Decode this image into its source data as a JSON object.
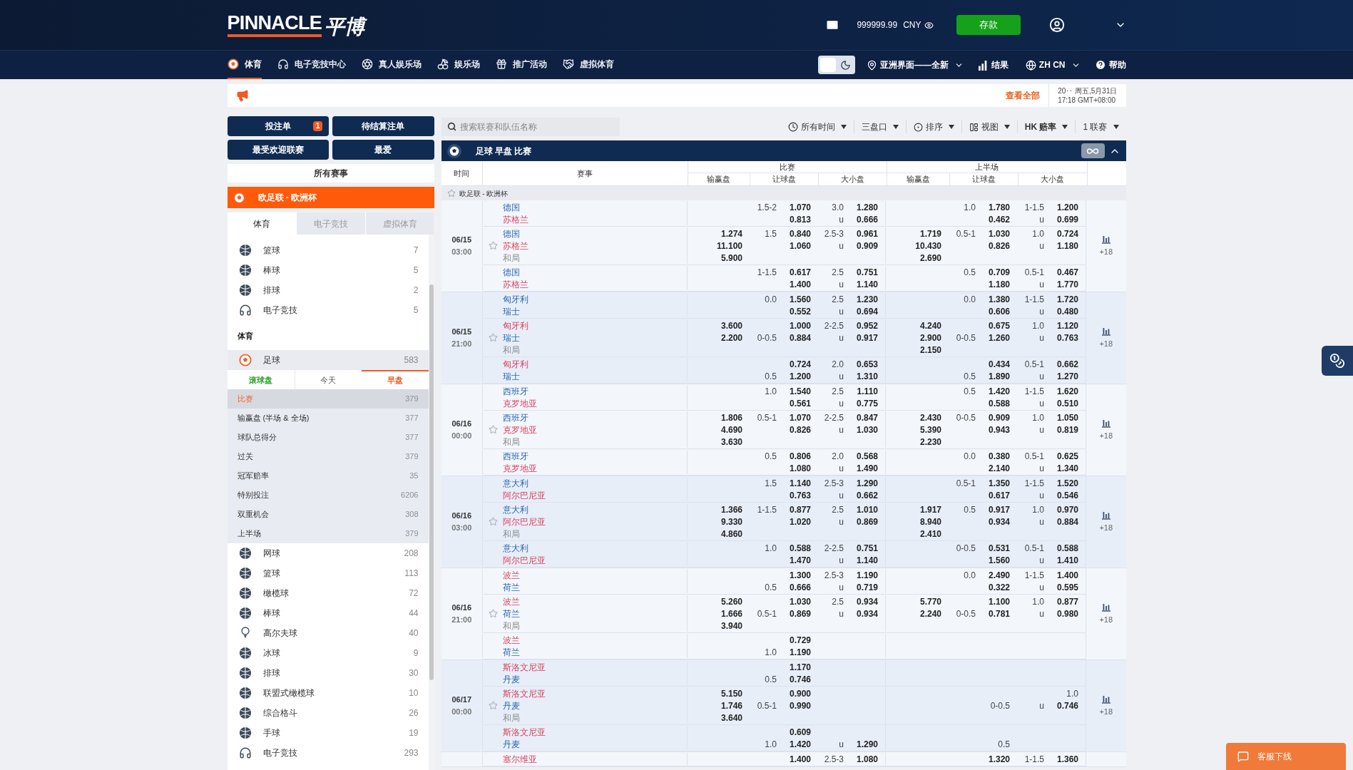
{
  "header": {
    "logo": "PINNACLE",
    "logo_cn": "平博",
    "balance": "999999.99",
    "currency": "CNY",
    "deposit": "存款"
  },
  "nav": [
    {
      "label": "体育",
      "selected": true
    },
    {
      "label": "电子竞技中心",
      "selected": false
    },
    {
      "label": "真人娱乐场",
      "selected": false
    },
    {
      "label": "娱乐场",
      "selected": false
    },
    {
      "label": "推广活动",
      "selected": false
    },
    {
      "label": "虚拟体育",
      "selected": false
    }
  ],
  "nav_right": {
    "dark_mode": false,
    "view": "亚洲界面——全新",
    "results": "结果",
    "language": "ZH CN",
    "help": "帮助"
  },
  "announcement": {
    "view_all": "查看全部",
    "date": "20‥ 周五,5月31日",
    "time": "17:18 GMT+08:00"
  },
  "sidebar": {
    "buttons": [
      {
        "label": "投注单",
        "badge": "1"
      },
      {
        "label": "待结算注单"
      },
      {
        "label": "最受欢迎联赛"
      },
      {
        "label": "最爱"
      }
    ],
    "all_events": "所有赛事",
    "league": "欧足联 - 欧洲杯",
    "tabs": [
      {
        "label": "体育",
        "selected": true
      },
      {
        "label": "电子竞技",
        "selected": false
      },
      {
        "label": "虚拟体育",
        "selected": false
      }
    ],
    "top_sports": [
      {
        "name": "篮球",
        "count": "7"
      },
      {
        "name": "棒球",
        "count": "5"
      },
      {
        "name": "排球",
        "count": "2"
      },
      {
        "name": "电子竞技",
        "count": "5"
      }
    ],
    "section": "体育",
    "featured": {
      "name": "足球",
      "count": "583",
      "expanded": true,
      "periods": [
        {
          "label": "滚球盘",
          "selected": false
        },
        {
          "label": "今天",
          "selected": false
        },
        {
          "label": "早盘",
          "selected": true
        }
      ],
      "markets": [
        {
          "name": "比赛",
          "count": "379",
          "selected": true
        },
        {
          "name": "输赢盘 (半场 & 全场)",
          "count": "377",
          "selected": false
        },
        {
          "name": "球队总得分",
          "count": "377",
          "selected": false
        },
        {
          "name": "过关",
          "count": "379",
          "selected": false
        },
        {
          "name": "冠军赔率",
          "count": "35",
          "selected": false
        },
        {
          "name": "特别投注",
          "count": "6206",
          "selected": false
        },
        {
          "name": "双重机会",
          "count": "308",
          "selected": false
        },
        {
          "name": "上半场",
          "count": "379",
          "selected": false
        }
      ]
    },
    "sports": [
      {
        "name": "网球",
        "count": "208"
      },
      {
        "name": "篮球",
        "count": "113"
      },
      {
        "name": "橄榄球",
        "count": "72"
      },
      {
        "name": "棒球",
        "count": "44"
      },
      {
        "name": "高尔夫球",
        "count": "40"
      },
      {
        "name": "冰球",
        "count": "9"
      },
      {
        "name": "排球",
        "count": "30"
      },
      {
        "name": "联盟式橄榄球",
        "count": "10"
      },
      {
        "name": "综合格斗",
        "count": "26"
      },
      {
        "name": "手球",
        "count": "19"
      },
      {
        "name": "电子竞技",
        "count": "293"
      }
    ]
  },
  "toolbar": {
    "search_placeholder": "搜索联赛和队伍名称",
    "filters": [
      "所有时间",
      "三盘口",
      "排序",
      "视图",
      "HK 赔率",
      "1 联赛"
    ]
  },
  "table": {
    "title": "足球 早盘 比赛",
    "time_header": "时间",
    "event_header": "赛事",
    "column_groups": [
      {
        "label": "比赛",
        "columns": [
          "输赢盘",
          "让球盘",
          "大小盘"
        ]
      },
      {
        "label": "上半场",
        "columns": [
          "输赢盘",
          "让球盘",
          "大小盘"
        ]
      }
    ],
    "league": "欧足联 - 欧洲杯",
    "groups": [
      {
        "date": "06/15",
        "time": "03:00",
        "more": "+18",
        "lines": [
          {
            "teams": [
              {
                "name": "德国",
                "favorite": false
              },
              {
                "name": "苏格兰",
                "favorite": true
              }
            ],
            "rows": [
              {
                "hdp": "1.5-2",
                "hdp_odds": "1.070",
                "ou": "3.0",
                "ou_odds": "1.280",
                "h1_hdp": "1.0",
                "h1_hdp_odds": "1.780",
                "h1_ou": "1-1.5",
                "h1_ou_odds": "1.200"
              },
              {
                "hdp_odds": "0.813",
                "ou": "u",
                "ou_odds": "0.666",
                "h1_hdp_odds": "0.462",
                "h1_ou": "u",
                "h1_ou_odds": "0.699"
              }
            ]
          },
          {
            "teams": [
              {
                "name": "德国",
                "favorite": false
              },
              {
                "name": "苏格兰",
                "favorite": true
              }
            ],
            "draw": "和局",
            "rows": [
              {
                "ml": "1.274",
                "hdp": "1.5",
                "hdp_odds": "0.840",
                "ou": "2.5-3",
                "ou_odds": "0.961",
                "h1_ml": "1.719",
                "h1_hdp": "0.5-1",
                "h1_hdp_odds": "1.030",
                "h1_ou": "1.0",
                "h1_ou_odds": "0.724"
              },
              {
                "ml": "11.100",
                "hdp_odds": "1.060",
                "ou": "u",
                "ou_odds": "0.909",
                "h1_ml": "10.430",
                "h1_hdp_odds": "0.826",
                "h1_ou": "u",
                "h1_ou_odds": "1.180"
              },
              {
                "ml": "5.900",
                "h1_ml": "2.690"
              }
            ]
          },
          {
            "teams": [
              {
                "name": "德国",
                "favorite": false
              },
              {
                "name": "苏格兰",
                "favorite": true
              }
            ],
            "rows": [
              {
                "hdp": "1-1.5",
                "hdp_odds": "0.617",
                "ou": "2.5",
                "ou_odds": "0.751",
                "h1_hdp": "0.5",
                "h1_hdp_odds": "0.709",
                "h1_ou": "0.5-1",
                "h1_ou_odds": "0.467"
              },
              {
                "hdp_odds": "1.400",
                "ou": "u",
                "ou_odds": "1.140",
                "h1_hdp_odds": "1.180",
                "h1_ou": "u",
                "h1_ou_odds": "1.770"
              }
            ]
          }
        ]
      },
      {
        "date": "06/15",
        "time": "21:00",
        "more": "+18",
        "lines": [
          {
            "teams": [
              {
                "name": "匈牙利",
                "favorite": false
              },
              {
                "name": "瑞士",
                "favorite": false
              }
            ],
            "rows": [
              {
                "hdp": "0.0",
                "hdp_odds": "1.560",
                "ou": "2.5",
                "ou_odds": "1.230",
                "h1_hdp": "0.0",
                "h1_hdp_odds": "1.380",
                "h1_ou": "1-1.5",
                "h1_ou_odds": "1.720"
              },
              {
                "hdp_odds": "0.552",
                "ou": "u",
                "ou_odds": "0.694",
                "h1_hdp_odds": "0.606",
                "h1_ou": "u",
                "h1_ou_odds": "0.480"
              }
            ]
          },
          {
            "teams": [
              {
                "name": "匈牙利",
                "favorite": true
              },
              {
                "name": "瑞士",
                "favorite": false
              }
            ],
            "draw": "和局",
            "rows": [
              {
                "ml": "3.600",
                "hdp_odds": "1.000",
                "ou": "2-2.5",
                "ou_odds": "0.952",
                "h1_ml": "4.240",
                "h1_hdp_odds": "0.675",
                "h1_ou": "1.0",
                "h1_ou_odds": "1.120"
              },
              {
                "ml": "2.200",
                "hdp": "0-0.5",
                "hdp_odds": "0.884",
                "ou": "u",
                "ou_odds": "0.917",
                "h1_ml": "2.900",
                "h1_hdp": "0-0.5",
                "h1_hdp_odds": "1.260",
                "h1_ou": "u",
                "h1_ou_odds": "0.763"
              },
              {
                "h1_ml": "2.150"
              }
            ]
          },
          {
            "teams": [
              {
                "name": "匈牙利",
                "favorite": true
              },
              {
                "name": "瑞士",
                "favorite": false
              }
            ],
            "rows": [
              {
                "hdp_odds": "0.724",
                "ou": "2.0",
                "ou_odds": "0.653",
                "h1_hdp_odds": "0.434",
                "h1_ou": "0.5-1",
                "h1_ou_odds": "0.662"
              },
              {
                "hdp": "0.5",
                "hdp_odds": "1.200",
                "ou": "u",
                "ou_odds": "1.310",
                "h1_hdp": "0.5",
                "h1_hdp_odds": "1.890",
                "h1_ou": "u",
                "h1_ou_odds": "1.270"
              }
            ]
          }
        ]
      },
      {
        "date": "06/16",
        "time": "00:00",
        "more": "+18",
        "lines": [
          {
            "teams": [
              {
                "name": "西班牙",
                "favorite": false
              },
              {
                "name": "克罗地亚",
                "favorite": true
              }
            ],
            "rows": [
              {
                "hdp": "1.0",
                "hdp_odds": "1.540",
                "ou": "2.5",
                "ou_odds": "1.110",
                "h1_hdp": "0.5",
                "h1_hdp_odds": "1.420",
                "h1_ou": "1-1.5",
                "h1_ou_odds": "1.620"
              },
              {
                "hdp_odds": "0.561",
                "ou": "u",
                "ou_odds": "0.775",
                "h1_hdp_odds": "0.588",
                "h1_ou": "u",
                "h1_ou_odds": "0.510"
              }
            ]
          },
          {
            "teams": [
              {
                "name": "西班牙",
                "favorite": false
              },
              {
                "name": "克罗地亚",
                "favorite": true
              }
            ],
            "draw": "和局",
            "rows": [
              {
                "ml": "1.806",
                "hdp": "0.5-1",
                "hdp_odds": "1.070",
                "ou": "2-2.5",
                "ou_odds": "0.847",
                "h1_ml": "2.430",
                "h1_hdp": "0-0.5",
                "h1_hdp_odds": "0.909",
                "h1_ou": "1.0",
                "h1_ou_odds": "1.050"
              },
              {
                "ml": "4.690",
                "hdp_odds": "0.826",
                "ou": "u",
                "ou_odds": "1.030",
                "h1_ml": "5.390",
                "h1_hdp_odds": "0.943",
                "h1_ou": "u",
                "h1_ou_odds": "0.819"
              },
              {
                "ml": "3.630",
                "h1_ml": "2.230"
              }
            ]
          },
          {
            "teams": [
              {
                "name": "西班牙",
                "favorite": false
              },
              {
                "name": "克罗地亚",
                "favorite": true
              }
            ],
            "rows": [
              {
                "hdp": "0.5",
                "hdp_odds": "0.806",
                "ou": "2.0",
                "ou_odds": "0.568",
                "h1_hdp": "0.0",
                "h1_hdp_odds": "0.380",
                "h1_ou": "0.5-1",
                "h1_ou_odds": "0.625"
              },
              {
                "hdp_odds": "1.080",
                "ou": "u",
                "ou_odds": "1.490",
                "h1_hdp_odds": "2.140",
                "h1_ou": "u",
                "h1_ou_odds": "1.340"
              }
            ]
          }
        ]
      },
      {
        "date": "06/16",
        "time": "03:00",
        "more": "+18",
        "lines": [
          {
            "teams": [
              {
                "name": "意大利",
                "favorite": false
              },
              {
                "name": "阿尔巴尼亚",
                "favorite": true
              }
            ],
            "rows": [
              {
                "hdp": "1.5",
                "hdp_odds": "1.140",
                "ou": "2.5-3",
                "ou_odds": "1.290",
                "h1_hdp": "0.5-1",
                "h1_hdp_odds": "1.350",
                "h1_ou": "1-1.5",
                "h1_ou_odds": "1.520"
              },
              {
                "hdp_odds": "0.763",
                "ou": "u",
                "ou_odds": "0.662",
                "h1_hdp_odds": "0.617",
                "h1_ou": "u",
                "h1_ou_odds": "0.546"
              }
            ]
          },
          {
            "teams": [
              {
                "name": "意大利",
                "favorite": false
              },
              {
                "name": "阿尔巴尼亚",
                "favorite": true
              }
            ],
            "draw": "和局",
            "rows": [
              {
                "ml": "1.366",
                "hdp": "1-1.5",
                "hdp_odds": "0.877",
                "ou": "2.5",
                "ou_odds": "1.010",
                "h1_ml": "1.917",
                "h1_hdp": "0.5",
                "h1_hdp_odds": "0.917",
                "h1_ou": "1.0",
                "h1_ou_odds": "0.970"
              },
              {
                "ml": "9.330",
                "hdp_odds": "1.020",
                "ou": "u",
                "ou_odds": "0.869",
                "h1_ml": "8.940",
                "h1_hdp_odds": "0.934",
                "h1_ou": "u",
                "h1_ou_odds": "0.884"
              },
              {
                "ml": "4.860",
                "h1_ml": "2.410"
              }
            ]
          },
          {
            "teams": [
              {
                "name": "意大利",
                "favorite": false
              },
              {
                "name": "阿尔巴尼亚",
                "favorite": true
              }
            ],
            "rows": [
              {
                "hdp": "1.0",
                "hdp_odds": "0.588",
                "ou": "2-2.5",
                "ou_odds": "0.751",
                "h1_hdp": "0-0.5",
                "h1_hdp_odds": "0.531",
                "h1_ou": "0.5-1",
                "h1_ou_odds": "0.588"
              },
              {
                "hdp_odds": "1.470",
                "ou": "u",
                "ou_odds": "1.140",
                "h1_hdp_odds": "1.560",
                "h1_ou": "u",
                "h1_ou_odds": "1.410"
              }
            ]
          }
        ]
      },
      {
        "date": "06/16",
        "time": "21:00",
        "more": "+18",
        "lines": [
          {
            "teams": [
              {
                "name": "波兰",
                "favorite": true
              },
              {
                "name": "荷兰",
                "favorite": false
              }
            ],
            "rows": [
              {
                "hdp_odds": "1.300",
                "ou": "2.5-3",
                "ou_odds": "1.190",
                "h1_hdp": "0.0",
                "h1_hdp_odds": "2.490",
                "h1_ou": "1-1.5",
                "h1_ou_odds": "1.400"
              },
              {
                "hdp": "0.5",
                "hdp_odds": "0.666",
                "ou": "u",
                "ou_odds": "0.719",
                "h1_hdp_odds": "0.322",
                "h1_ou": "u",
                "h1_ou_odds": "0.595"
              }
            ]
          },
          {
            "teams": [
              {
                "name": "波兰",
                "favorite": true
              },
              {
                "name": "荷兰",
                "favorite": false
              }
            ],
            "draw": "和局",
            "rows": [
              {
                "ml": "5.260",
                "hdp_odds": "1.030",
                "ou": "2.5",
                "ou_odds": "0.934",
                "h1_ml": "5.770",
                "h1_hdp_odds": "1.100",
                "h1_ou": "1.0",
                "h1_ou_odds": "0.877"
              },
              {
                "ml": "1.666",
                "hdp": "0.5-1",
                "hdp_odds": "0.869",
                "ou": "u",
                "ou_odds": "0.934",
                "h1_ml": "2.240",
                "h1_hdp": "0-0.5",
                "h1_hdp_odds": "0.781",
                "h1_ou": "u",
                "h1_ou_odds": "0.980"
              },
              {
                "ml": "3.940"
              }
            ]
          },
          {
            "teams": [
              {
                "name": "波兰",
                "favorite": true
              },
              {
                "name": "荷兰",
                "favorite": false
              }
            ],
            "rows": [
              {
                "hdp_odds": "0.729"
              },
              {
                "hdp": "1.0",
                "hdp_odds": "1.190"
              }
            ]
          }
        ]
      },
      {
        "date": "06/17",
        "time": "00:00",
        "more": "+18",
        "lines": [
          {
            "teams": [
              {
                "name": "斯洛文尼亚",
                "favorite": true
              },
              {
                "name": "丹麦",
                "favorite": false
              }
            ],
            "rows": [
              {
                "hdp_odds": "1.170"
              },
              {
                "hdp": "0.5",
                "hdp_odds": "0.746"
              }
            ]
          },
          {
            "teams": [
              {
                "name": "斯洛文尼亚",
                "favorite": true
              },
              {
                "name": "丹麦",
                "favorite": false
              }
            ],
            "draw": "和局",
            "rows": [
              {
                "ml": "5.150",
                "hdp_odds": "0.900",
                "h1_ou": "1.0"
              },
              {
                "ml": "1.746",
                "hdp": "0.5-1",
                "hdp_odds": "0.990",
                "h1_hdp": "0-0.5",
                "h1_ou": "u",
                "h1_ou_odds": "0.746"
              },
              {
                "ml": "3.640"
              }
            ]
          },
          {
            "teams": [
              {
                "name": "斯洛文尼亚",
                "favorite": true
              },
              {
                "name": "丹麦",
                "favorite": false
              }
            ],
            "rows": [
              {
                "hdp_odds": "0.609"
              },
              {
                "hdp": "1.0",
                "hdp_odds": "1.420",
                "ou": "u",
                "ou_odds": "1.290",
                "h1_hdp": "0.5"
              }
            ]
          }
        ]
      },
      {
        "lines": [
          {
            "teams": [
              {
                "name": "塞尔维亚",
                "favorite": true
              }
            ],
            "rows": [
              {
                "hdp_odds": "1.400",
                "ou": "2.5-3",
                "ou_odds": "1.080",
                "h1_hdp_odds": "1.320",
                "h1_ou": "1-1.5",
                "h1_ou_odds": "1.360"
              }
            ]
          }
        ]
      }
    ]
  },
  "support": "客服下线"
}
